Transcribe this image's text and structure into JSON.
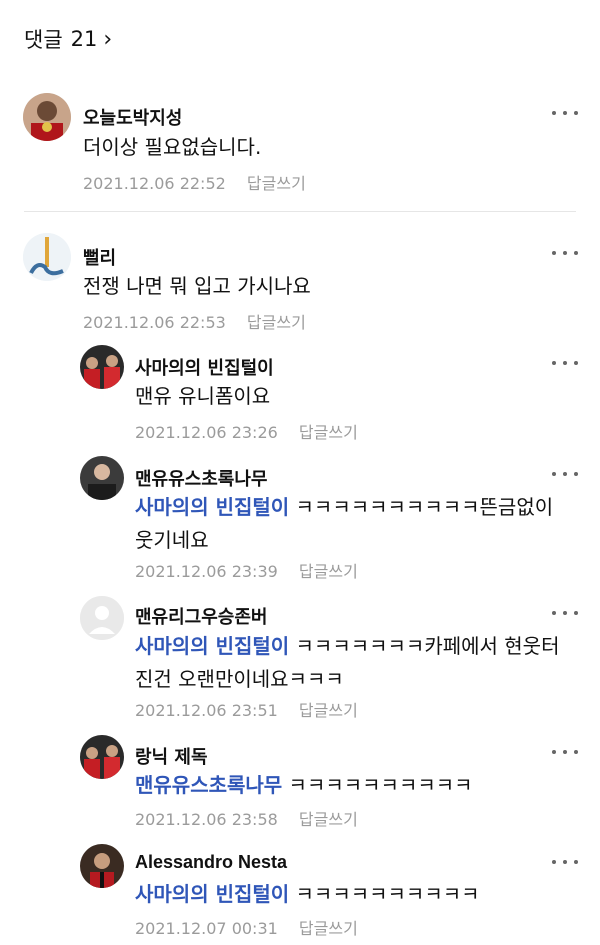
{
  "header": {
    "title": "댓글",
    "count": "21",
    "chevron": "›"
  },
  "comments": [
    {
      "author": "오늘도박지성",
      "text": "더이상 필요없습니다.",
      "date": "2021.12.06 22:52",
      "reply": "답글쓰기"
    },
    {
      "author": "뻘리",
      "text": "전쟁 나면 뭐 입고 가시나요",
      "date": "2021.12.06 22:53",
      "reply": "답글쓰기"
    }
  ],
  "replies": [
    {
      "author": "사마의의 빈집털이",
      "mention": "",
      "text": "맨유 유니폼이요",
      "date": "2021.12.06 23:26",
      "reply": "답글쓰기"
    },
    {
      "author": "맨유유스초록나무",
      "mention": "사마의의 빈집털이",
      "text": " ㅋㅋㅋㅋㅋㅋㅋㅋㅋㅋ뜬금없이 웃기네요",
      "date": "2021.12.06 23:39",
      "reply": "답글쓰기"
    },
    {
      "author": "맨유리그우승존버",
      "mention": "사마의의 빈집털이",
      "text": " ㅋㅋㅋㅋㅋㅋㅋ카페에서 현웃터진건 오랜만이네요ㅋㅋㅋ",
      "date": "2021.12.06 23:51",
      "reply": "답글쓰기"
    },
    {
      "author": "랑닉 제독",
      "mention": "맨유유스초록나무",
      "text": " ㅋㅋㅋㅋㅋㅋㅋㅋㅋㅋ",
      "date": "2021.12.06 23:58",
      "reply": "답글쓰기"
    },
    {
      "author": "Alessandro Nesta",
      "mention": "사마의의 빈집털이",
      "text": " ㅋㅋㅋㅋㅋㅋㅋㅋㅋㅋ",
      "date": "2021.12.07 00:31",
      "reply": "답글쓰기"
    }
  ]
}
